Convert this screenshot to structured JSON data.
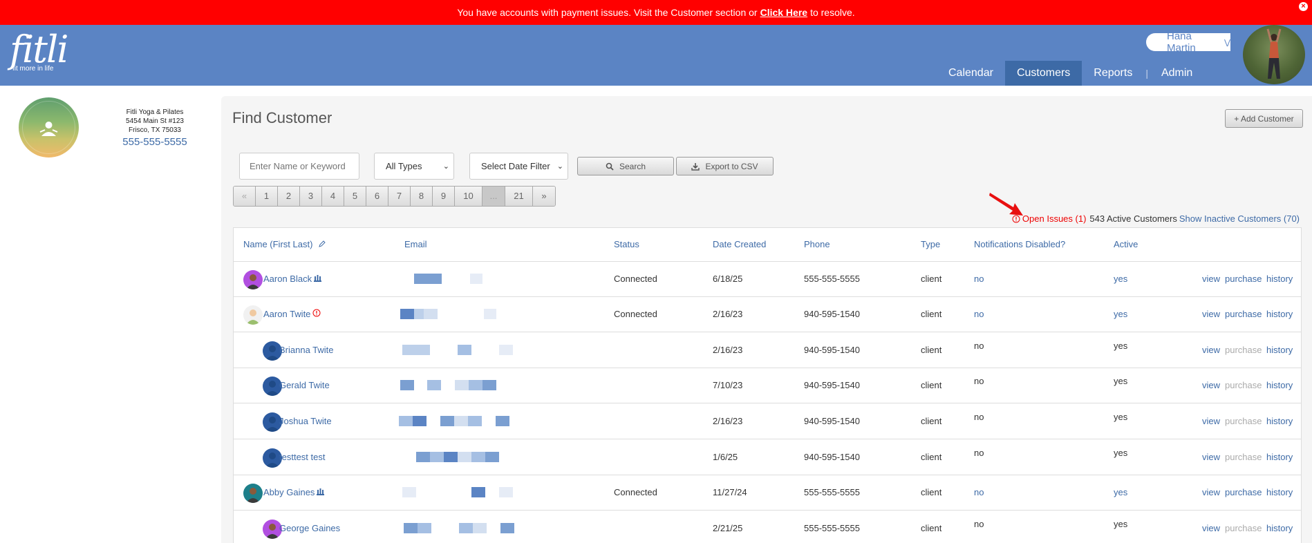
{
  "alert": {
    "text_before": "You have accounts with payment issues. Visit the Customer section or",
    "link": "Click Here",
    "text_after": "to resolve.",
    "close_icon": "close-icon"
  },
  "header": {
    "logo_word": "fitli",
    "logo_tagline": "fit more in life",
    "user_name": "Hana Martin",
    "nav": [
      "Calendar",
      "Customers",
      "Reports",
      "Admin"
    ],
    "active_tab": "Customers"
  },
  "studio": {
    "name": "Fitli Yoga & Pilates",
    "address1": "5454 Main St #123",
    "address2": "Frisco, TX 75033",
    "phone": "555-555-5555",
    "logo_text": "FITLI YOGA & PILATES"
  },
  "main": {
    "title": "Find Customer",
    "add_button": "+ Add Customer",
    "search_placeholder": "Enter Name or Keyword",
    "type_select": "All Types",
    "date_select": "Select Date Filter",
    "search_button": "Search",
    "export_button": "Export to CSV",
    "pager": [
      "«",
      "1",
      "2",
      "3",
      "4",
      "5",
      "6",
      "7",
      "8",
      "9",
      "10",
      "...",
      "21",
      "»"
    ],
    "open_issues": "Open Issues (1)",
    "active_count": "543 Active Customers",
    "show_inactive": "Show Inactive Customers (70)"
  },
  "table": {
    "headers": [
      "Name (First Last)",
      "Email",
      "Status",
      "Date Created",
      "Phone",
      "Type",
      "Notifications Disabled?",
      "Active"
    ],
    "actions": [
      "view",
      "purchase",
      "history"
    ],
    "rows": [
      {
        "name": "Aaron Black",
        "status": "Connected",
        "date": "6/18/25",
        "phone": "555-555-5555",
        "type": "client",
        "notif": "no",
        "active": "yes",
        "badge": "family-icon"
      },
      {
        "name": "Aaron Twite",
        "status": "Connected",
        "date": "2/16/23",
        "phone": "940-595-1540",
        "type": "client",
        "notif": "no",
        "active": "yes",
        "badge": "alert-icon"
      },
      {
        "name": "Brianna Twite",
        "status": "",
        "date": "2/16/23",
        "phone": "940-595-1540",
        "type": "client",
        "notif": "no",
        "active": "yes",
        "badge": ""
      },
      {
        "name": "Gerald Twite",
        "status": "",
        "date": "7/10/23",
        "phone": "940-595-1540",
        "type": "client",
        "notif": "no",
        "active": "yes",
        "badge": ""
      },
      {
        "name": "Joshua Twite",
        "status": "",
        "date": "2/16/23",
        "phone": "940-595-1540",
        "type": "client",
        "notif": "no",
        "active": "yes",
        "badge": ""
      },
      {
        "name": "testtest test",
        "status": "",
        "date": "1/6/25",
        "phone": "940-595-1540",
        "type": "client",
        "notif": "no",
        "active": "yes",
        "badge": ""
      },
      {
        "name": "Abby Gaines",
        "status": "Connected",
        "date": "11/27/24",
        "phone": "555-555-5555",
        "type": "client",
        "notif": "no",
        "active": "yes",
        "badge": "family-icon"
      },
      {
        "name": "George Gaines",
        "status": "",
        "date": "2/21/25",
        "phone": "555-555-5555",
        "type": "client",
        "notif": "no",
        "active": "yes",
        "badge": ""
      }
    ]
  },
  "colors": {
    "alert_bg": "#ff0000",
    "header_bg": "#5b84c4",
    "active_tab": "#3d6aa6",
    "link": "#3d6aa6"
  }
}
